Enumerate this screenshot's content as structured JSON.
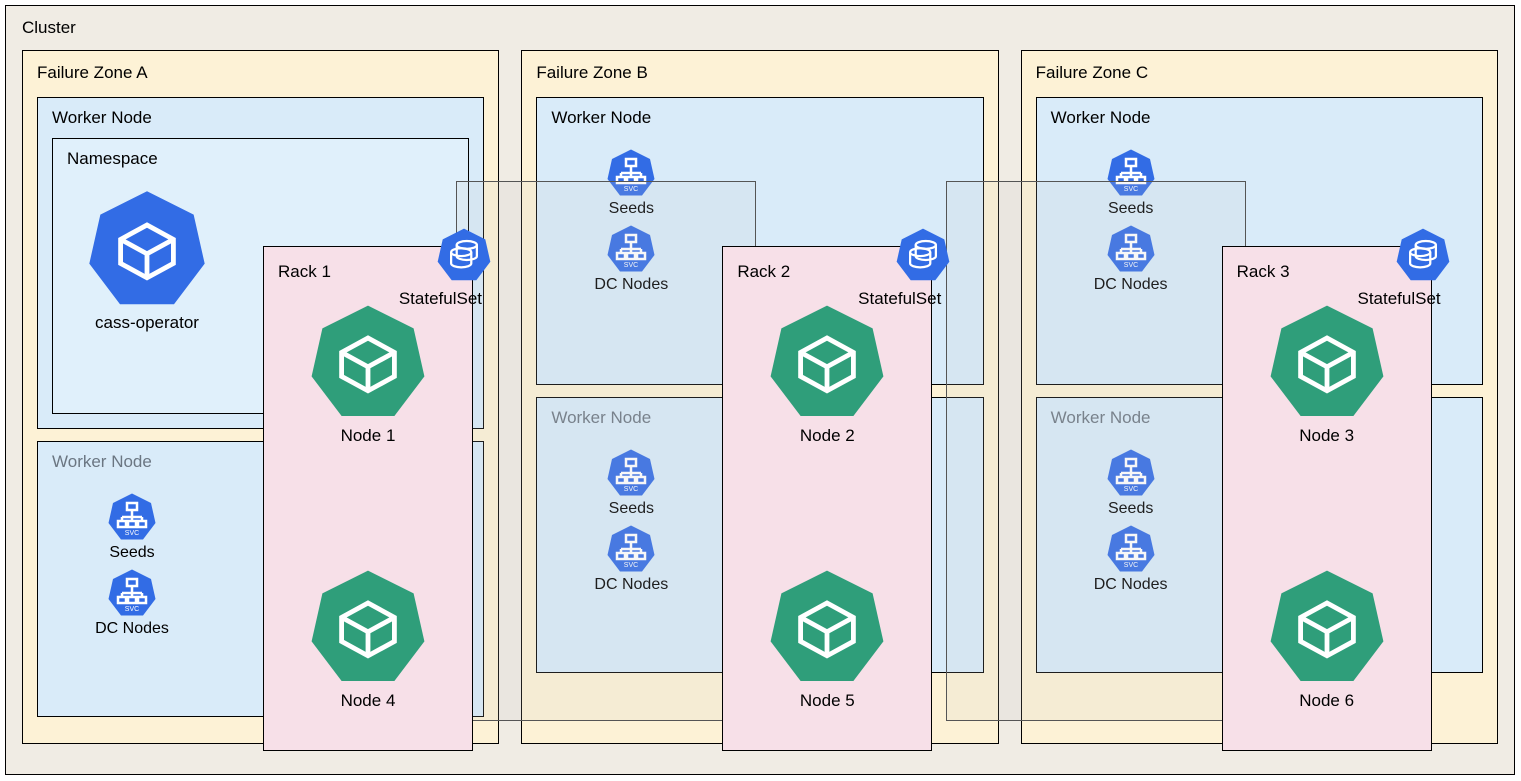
{
  "cluster": {
    "label": "Cluster"
  },
  "zones": [
    {
      "label": "Failure Zone A",
      "rack_label": "Rack 1",
      "stateful_label": "StatefulSet",
      "top": {
        "worker_label": "Worker Node",
        "namespace_label": "Namespace",
        "left_kind": "operator",
        "operator_label": "cass-operator",
        "node_label": "Node 1"
      },
      "bottom": {
        "worker_label": "Worker Node",
        "seeds": "Seeds",
        "dcnodes": "DC Nodes",
        "node_label": "Node 4"
      }
    },
    {
      "label": "Failure Zone B",
      "rack_label": "Rack 2",
      "stateful_label": "StatefulSet",
      "top": {
        "worker_label": "Worker Node",
        "seeds": "Seeds",
        "dcnodes": "DC Nodes",
        "node_label": "Node 2"
      },
      "bottom": {
        "worker_label": "Worker Node",
        "seeds": "Seeds",
        "dcnodes": "DC Nodes",
        "node_label": "Node 5"
      }
    },
    {
      "label": "Failure Zone C",
      "rack_label": "Rack 3",
      "stateful_label": "StatefulSet",
      "top": {
        "worker_label": "Worker Node",
        "seeds": "Seeds",
        "dcnodes": "DC Nodes",
        "node_label": "Node 3"
      },
      "bottom": {
        "worker_label": "Worker Node",
        "seeds": "Seeds",
        "dcnodes": "DC Nodes",
        "node_label": "Node 6"
      }
    }
  ],
  "colors": {
    "blue": "#326ce5",
    "green": "#2f9e7a"
  }
}
